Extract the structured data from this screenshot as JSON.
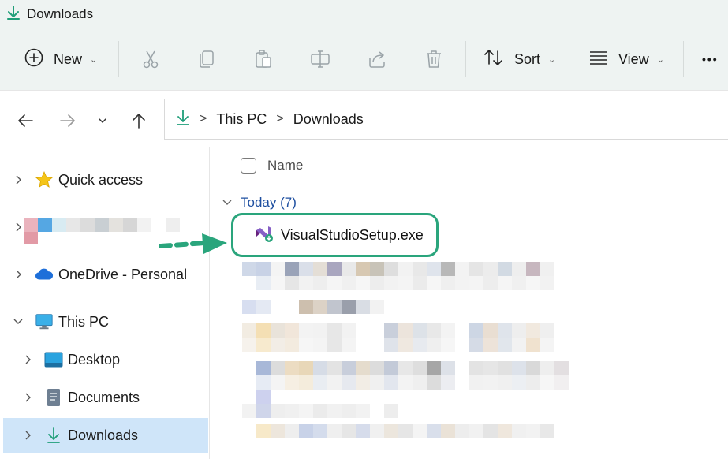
{
  "window": {
    "title": "Downloads"
  },
  "toolbar": {
    "new_label": "New",
    "sort_label": "Sort",
    "view_label": "View",
    "more_label": "•••"
  },
  "address": {
    "segments": [
      "This PC",
      "Downloads"
    ],
    "separator": ">"
  },
  "sidebar": {
    "items": [
      {
        "label": "Quick access"
      },
      {
        "label": ""
      },
      {
        "label": "OneDrive - Personal"
      },
      {
        "label": "This PC"
      },
      {
        "label": "Desktop"
      },
      {
        "label": "Documents"
      },
      {
        "label": "Downloads"
      }
    ]
  },
  "content": {
    "column_name": "Name",
    "group_label": "Today (7)",
    "highlighted_file": "VisualStudioSetup.exe"
  },
  "colors": {
    "accent_green": "#2aa57c",
    "selection": "#cfe5f9",
    "group_text": "#1e4fa0"
  },
  "icons": [
    "download-arrow-icon",
    "plus-circle-icon",
    "cut-icon",
    "copy-icon",
    "paste-icon",
    "rename-icon",
    "share-icon",
    "delete-icon",
    "sort-icon",
    "view-icon",
    "back-icon",
    "forward-icon",
    "up-icon",
    "star-icon",
    "cloud-icon",
    "pc-icon",
    "desktop-icon",
    "documents-icon",
    "visual-studio-icon"
  ]
}
